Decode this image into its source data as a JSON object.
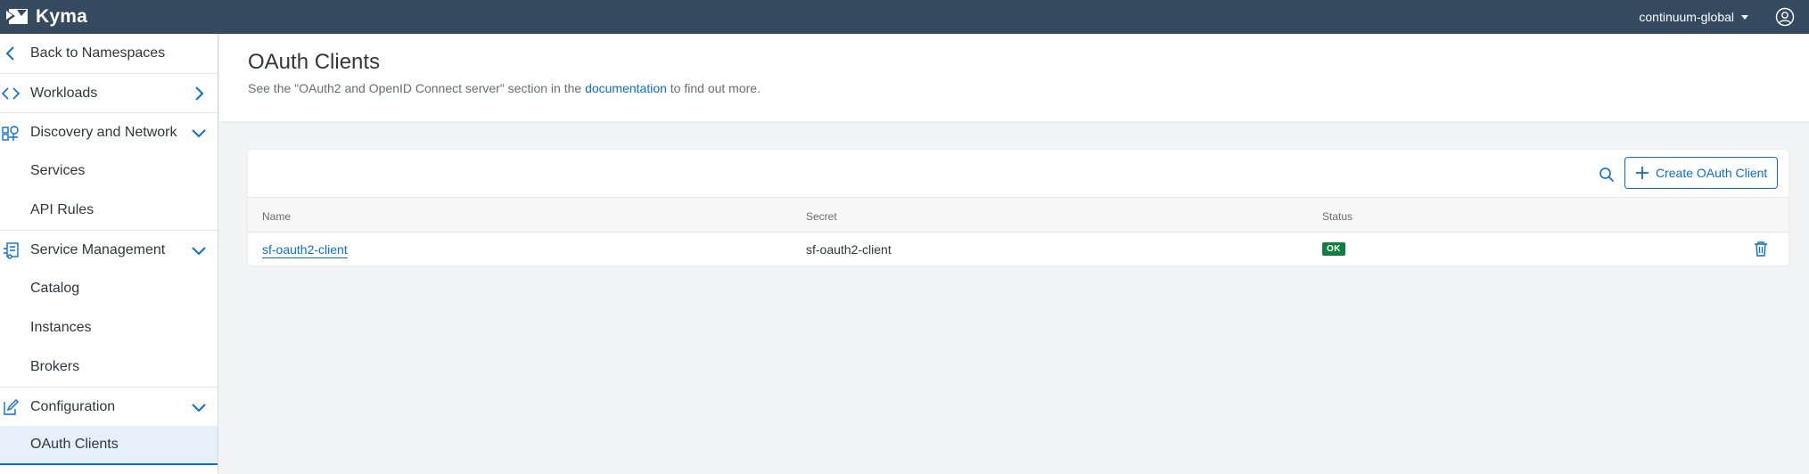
{
  "app": {
    "brand": "Kyma",
    "namespace": "continuum-global"
  },
  "colors": {
    "shellbar": "#354a5f",
    "accent": "#0a6ed1",
    "status_ok": "#107e3e",
    "selected_bg": "#e5f0fa"
  },
  "sidebar": {
    "back": "Back to Namespaces",
    "workloads": "Workloads",
    "discovery": "Discovery and Network",
    "services": "Services",
    "api_rules": "API Rules",
    "service_management": "Service Management",
    "catalog": "Catalog",
    "instances": "Instances",
    "brokers": "Brokers",
    "configuration": "Configuration",
    "oauth_clients": "OAuth Clients"
  },
  "header": {
    "title": "OAuth Clients",
    "desc_before": "See the \"OAuth2 and OpenID Connect server\" section in the ",
    "desc_link": "documentation",
    "desc_after": " to find out more."
  },
  "toolbar": {
    "create_label": "Create OAuth Client"
  },
  "table": {
    "columns": [
      "Name",
      "Secret",
      "Status"
    ],
    "rows": [
      {
        "name": "sf-oauth2-client",
        "secret": "sf-oauth2-client",
        "status": "OK"
      }
    ]
  }
}
